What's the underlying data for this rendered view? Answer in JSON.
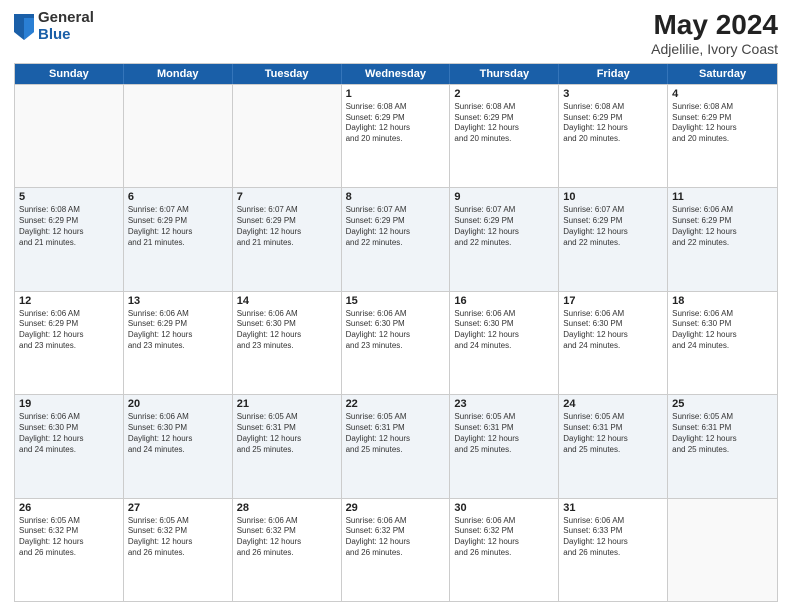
{
  "logo": {
    "general": "General",
    "blue": "Blue"
  },
  "title": "May 2024",
  "subtitle": "Adjelilie, Ivory Coast",
  "days": [
    "Sunday",
    "Monday",
    "Tuesday",
    "Wednesday",
    "Thursday",
    "Friday",
    "Saturday"
  ],
  "weeks": [
    [
      {
        "day": "",
        "info": ""
      },
      {
        "day": "",
        "info": ""
      },
      {
        "day": "",
        "info": ""
      },
      {
        "day": "1",
        "info": "Sunrise: 6:08 AM\nSunset: 6:29 PM\nDaylight: 12 hours\nand 20 minutes."
      },
      {
        "day": "2",
        "info": "Sunrise: 6:08 AM\nSunset: 6:29 PM\nDaylight: 12 hours\nand 20 minutes."
      },
      {
        "day": "3",
        "info": "Sunrise: 6:08 AM\nSunset: 6:29 PM\nDaylight: 12 hours\nand 20 minutes."
      },
      {
        "day": "4",
        "info": "Sunrise: 6:08 AM\nSunset: 6:29 PM\nDaylight: 12 hours\nand 20 minutes."
      }
    ],
    [
      {
        "day": "5",
        "info": "Sunrise: 6:08 AM\nSunset: 6:29 PM\nDaylight: 12 hours\nand 21 minutes."
      },
      {
        "day": "6",
        "info": "Sunrise: 6:07 AM\nSunset: 6:29 PM\nDaylight: 12 hours\nand 21 minutes."
      },
      {
        "day": "7",
        "info": "Sunrise: 6:07 AM\nSunset: 6:29 PM\nDaylight: 12 hours\nand 21 minutes."
      },
      {
        "day": "8",
        "info": "Sunrise: 6:07 AM\nSunset: 6:29 PM\nDaylight: 12 hours\nand 22 minutes."
      },
      {
        "day": "9",
        "info": "Sunrise: 6:07 AM\nSunset: 6:29 PM\nDaylight: 12 hours\nand 22 minutes."
      },
      {
        "day": "10",
        "info": "Sunrise: 6:07 AM\nSunset: 6:29 PM\nDaylight: 12 hours\nand 22 minutes."
      },
      {
        "day": "11",
        "info": "Sunrise: 6:06 AM\nSunset: 6:29 PM\nDaylight: 12 hours\nand 22 minutes."
      }
    ],
    [
      {
        "day": "12",
        "info": "Sunrise: 6:06 AM\nSunset: 6:29 PM\nDaylight: 12 hours\nand 23 minutes."
      },
      {
        "day": "13",
        "info": "Sunrise: 6:06 AM\nSunset: 6:29 PM\nDaylight: 12 hours\nand 23 minutes."
      },
      {
        "day": "14",
        "info": "Sunrise: 6:06 AM\nSunset: 6:30 PM\nDaylight: 12 hours\nand 23 minutes."
      },
      {
        "day": "15",
        "info": "Sunrise: 6:06 AM\nSunset: 6:30 PM\nDaylight: 12 hours\nand 23 minutes."
      },
      {
        "day": "16",
        "info": "Sunrise: 6:06 AM\nSunset: 6:30 PM\nDaylight: 12 hours\nand 24 minutes."
      },
      {
        "day": "17",
        "info": "Sunrise: 6:06 AM\nSunset: 6:30 PM\nDaylight: 12 hours\nand 24 minutes."
      },
      {
        "day": "18",
        "info": "Sunrise: 6:06 AM\nSunset: 6:30 PM\nDaylight: 12 hours\nand 24 minutes."
      }
    ],
    [
      {
        "day": "19",
        "info": "Sunrise: 6:06 AM\nSunset: 6:30 PM\nDaylight: 12 hours\nand 24 minutes."
      },
      {
        "day": "20",
        "info": "Sunrise: 6:06 AM\nSunset: 6:30 PM\nDaylight: 12 hours\nand 24 minutes."
      },
      {
        "day": "21",
        "info": "Sunrise: 6:05 AM\nSunset: 6:31 PM\nDaylight: 12 hours\nand 25 minutes."
      },
      {
        "day": "22",
        "info": "Sunrise: 6:05 AM\nSunset: 6:31 PM\nDaylight: 12 hours\nand 25 minutes."
      },
      {
        "day": "23",
        "info": "Sunrise: 6:05 AM\nSunset: 6:31 PM\nDaylight: 12 hours\nand 25 minutes."
      },
      {
        "day": "24",
        "info": "Sunrise: 6:05 AM\nSunset: 6:31 PM\nDaylight: 12 hours\nand 25 minutes."
      },
      {
        "day": "25",
        "info": "Sunrise: 6:05 AM\nSunset: 6:31 PM\nDaylight: 12 hours\nand 25 minutes."
      }
    ],
    [
      {
        "day": "26",
        "info": "Sunrise: 6:05 AM\nSunset: 6:32 PM\nDaylight: 12 hours\nand 26 minutes."
      },
      {
        "day": "27",
        "info": "Sunrise: 6:05 AM\nSunset: 6:32 PM\nDaylight: 12 hours\nand 26 minutes."
      },
      {
        "day": "28",
        "info": "Sunrise: 6:06 AM\nSunset: 6:32 PM\nDaylight: 12 hours\nand 26 minutes."
      },
      {
        "day": "29",
        "info": "Sunrise: 6:06 AM\nSunset: 6:32 PM\nDaylight: 12 hours\nand 26 minutes."
      },
      {
        "day": "30",
        "info": "Sunrise: 6:06 AM\nSunset: 6:32 PM\nDaylight: 12 hours\nand 26 minutes."
      },
      {
        "day": "31",
        "info": "Sunrise: 6:06 AM\nSunset: 6:33 PM\nDaylight: 12 hours\nand 26 minutes."
      },
      {
        "day": "",
        "info": ""
      }
    ]
  ]
}
